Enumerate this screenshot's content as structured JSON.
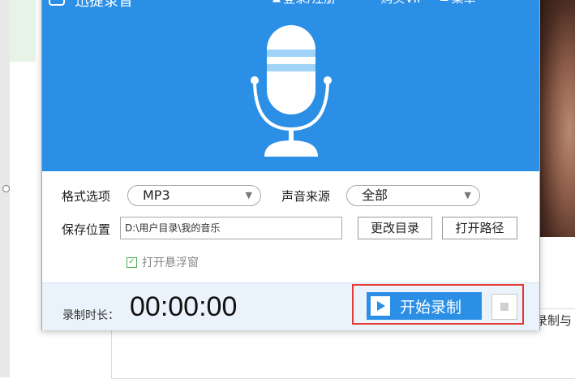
{
  "background": {
    "right_text": "录制与"
  },
  "titlebar": {
    "app_title": "迅捷录音",
    "login": "登录/注册",
    "buy_vip": "购买VIP",
    "menu": "菜单"
  },
  "form": {
    "format_label": "格式选项",
    "format_value": "MP3",
    "source_label": "声音来源",
    "source_value": "全部",
    "save_label": "保存位置",
    "save_path": "D:\\用户目录\\我的音乐",
    "change_dir_button": "更改目录",
    "open_path_button": "打开路径",
    "float_window_label": "打开悬浮窗",
    "float_window_checked": true
  },
  "footer": {
    "duration_label": "录制时长：",
    "duration_value": "00:00:00",
    "start_button": "开始录制"
  },
  "colors": {
    "header_blue": "#2b8fe6",
    "highlight_red": "#e53935",
    "mic_stripe": "#9fd3f7"
  }
}
